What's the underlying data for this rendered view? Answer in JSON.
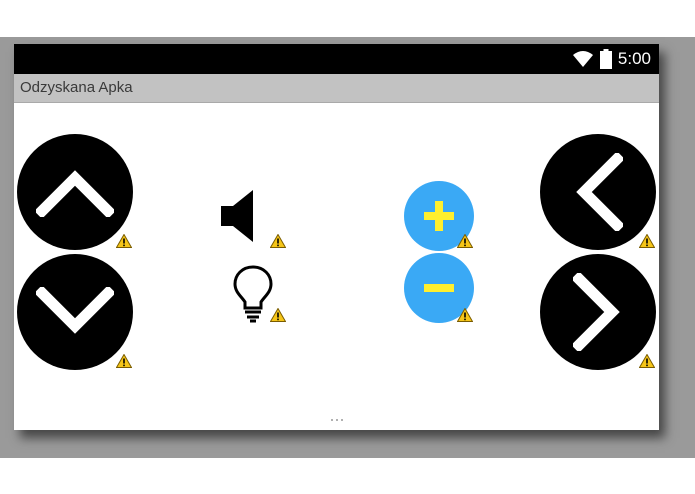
{
  "status_bar": {
    "time": "5:00",
    "icons": [
      "wifi-icon",
      "battery-icon"
    ]
  },
  "app": {
    "title": "Odzyskana Apka"
  },
  "controls": {
    "up": "chevron-up-icon",
    "down": "chevron-down-icon",
    "left": "chevron-left-icon",
    "right": "chevron-right-icon",
    "sound": "speaker-icon",
    "light": "lightbulb-icon",
    "plus": "plus-icon",
    "minus": "minus-icon"
  },
  "colors": {
    "status_bar": "#000000",
    "action_bar": "#c2c2c2",
    "round_button": "#000000",
    "fab": "#3aa9f5",
    "fab_glyph": "#ffef2e",
    "warning": "#f5c518"
  }
}
